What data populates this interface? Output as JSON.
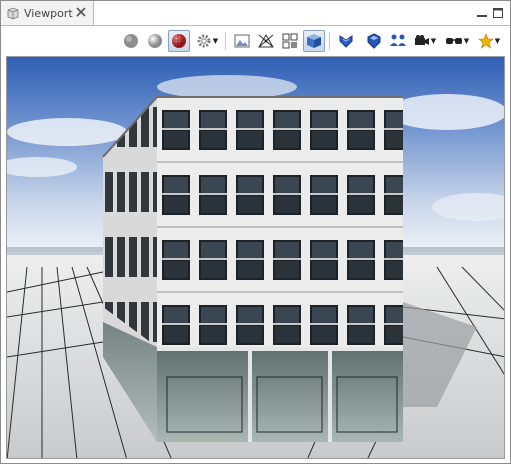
{
  "window": {
    "tab_title": "Viewport"
  },
  "toolbar": {
    "buttons": [
      "sphere-flat-icon",
      "sphere-smooth-icon",
      "sphere-textured-icon",
      "gear-icon",
      "image-icon",
      "wireframe-icon",
      "grid-icon",
      "cube-icon",
      "heart-shield-icon",
      "blue-shield-icon",
      "people-icon",
      "camera-icon",
      "glasses-icon",
      "star-icon"
    ]
  },
  "colors": {
    "sky_top": "#2f5fb5",
    "sky_bottom": "#e8eef6",
    "ground": "#d8dadc",
    "facade": "#e9e9e9",
    "accent_active": "#c9d6ea"
  }
}
